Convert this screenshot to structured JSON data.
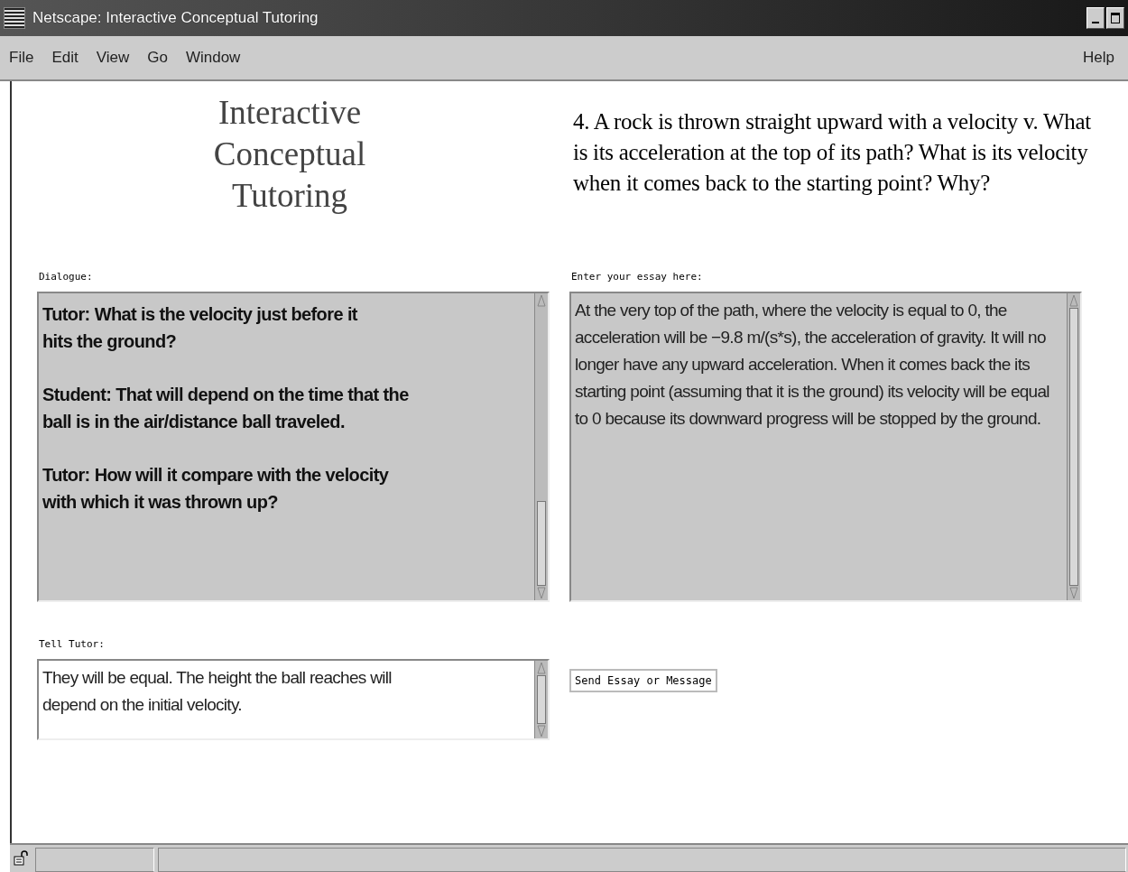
{
  "window": {
    "title": "Netscape: Interactive Conceptual Tutoring"
  },
  "menu": {
    "left": [
      "File",
      "Edit",
      "View",
      "Go",
      "Window"
    ],
    "right": [
      "Help"
    ]
  },
  "logo": [
    "Interactive",
    "Conceptual",
    "Tutoring"
  ],
  "question": "4. A rock is thrown straight upward with a velocity v. What is its acceleration at the top of its path? What is its velocity when it comes back to the starting point? Why?",
  "dialogue": {
    "label": "Dialogue:",
    "messages": [
      "Tutor: What is the velocity just before it\nhits the ground?",
      "Student: That will depend on the time that the\nball is in the air/distance ball traveled.",
      "Tutor: How will it compare with the velocity\nwith which it was thrown up?"
    ]
  },
  "essay": {
    "label": "Enter your essay here:",
    "value": "At the very top of the path, where the velocity is equal to 0, the acceleration will be −9.8 m/(s*s), the acceleration of gravity. It will no longer have any upward acceleration. When it comes back the its starting point (assuming that it is the ground) its velocity will be equal to 0 because its downward progress will be stopped by the ground."
  },
  "tell_tutor": {
    "label": "Tell Tutor:",
    "value": "They will be equal. The height the ball reaches will\ndepend on the initial velocity."
  },
  "send_button": "Send Essay or Message"
}
